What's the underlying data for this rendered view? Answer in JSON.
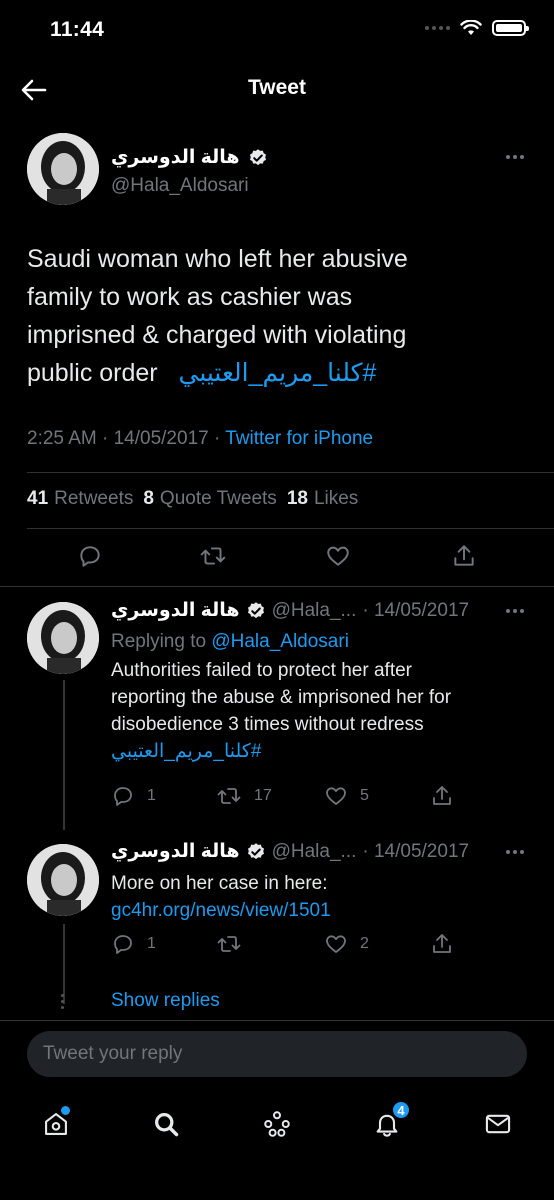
{
  "status_bar": {
    "time": "11:44"
  },
  "header": {
    "title": "Tweet"
  },
  "main_tweet": {
    "display_name": "هالة الدوسري",
    "handle": "@Hala_Aldosari",
    "text_line1": "Saudi woman who left her abusive",
    "text_line2": "family to work as cashier was",
    "text_line3": "imprisned & charged with violating",
    "text_line4": "public order",
    "hashtag": "#كلنا_مريم_العتيبي",
    "time": "2:25 AM",
    "date": "14/05/2017",
    "source": "Twitter for iPhone",
    "retweets": "41",
    "retweets_label": "Retweets",
    "quote_tweets": "8",
    "quote_tweets_label": "Quote Tweets",
    "likes": "18",
    "likes_label": "Likes"
  },
  "replies": [
    {
      "display_name": "هالة الدوسري",
      "handle": "@Hala_...",
      "date": "· 14/05/2017",
      "replying_label": "Replying to",
      "replying_to": "@Hala_Aldosari",
      "line1": "Authorities failed to protect her after",
      "line2": "reporting the abuse & imprisoned her for",
      "line3": "disobedience 3 times without redress",
      "hashtag": "#كلنا_مريم_العتيبي",
      "reply_count": "1",
      "retweet_count": "17",
      "like_count": "5"
    },
    {
      "display_name": "هالة الدوسري",
      "handle": "@Hala_...",
      "date": "· 14/05/2017",
      "line1": "More on her case in here:",
      "link": "gc4hr.org/news/view/1501",
      "reply_count": "1",
      "retweet_count": "",
      "like_count": "2"
    }
  ],
  "show_replies": "Show replies",
  "compose": {
    "placeholder": "Tweet your reply"
  },
  "tab_bar": {
    "items": [
      "home-icon",
      "search-icon",
      "spaces-icon",
      "notifications-icon",
      "messages-icon"
    ],
    "notifications_badge": "4"
  },
  "colors": {
    "accent": "#1d9bf0",
    "muted": "#71767b",
    "background": "#000000",
    "divider": "#2f3336"
  }
}
